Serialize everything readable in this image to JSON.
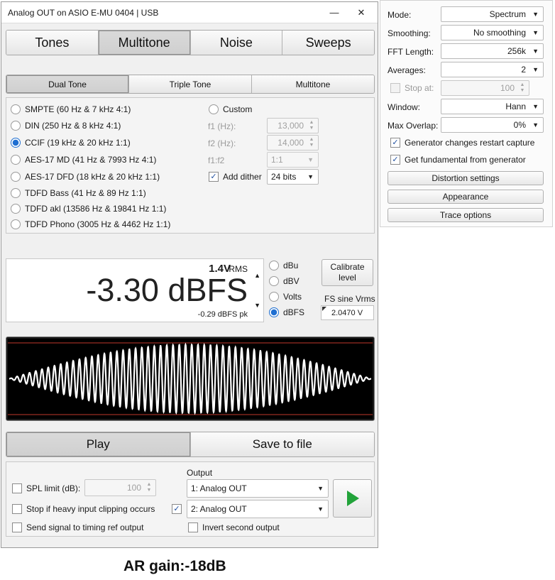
{
  "window": {
    "title": "Analog OUT on ASIO E-MU 0404 | USB",
    "minimize": "—",
    "maximize": "☐",
    "close": "✕"
  },
  "main_tabs": [
    {
      "label": "Tones",
      "selected": false
    },
    {
      "label": "Multitone",
      "selected": true
    },
    {
      "label": "Noise",
      "selected": false
    },
    {
      "label": "Sweeps",
      "selected": false
    }
  ],
  "sub_tabs": [
    {
      "label": "Dual Tone",
      "selected": true
    },
    {
      "label": "Triple Tone",
      "selected": false
    },
    {
      "label": "Multitone",
      "selected": false
    }
  ],
  "presets": [
    {
      "label": "SMPTE (60 Hz & 7 kHz 4:1)",
      "selected": false
    },
    {
      "label": "DIN (250 Hz & 8 kHz 4:1)",
      "selected": false
    },
    {
      "label": "CCIF (19 kHz & 20 kHz 1:1)",
      "selected": true
    },
    {
      "label": "AES-17 MD (41 Hz & 7993 Hz 4:1)",
      "selected": false
    },
    {
      "label": "AES-17 DFD (18 kHz & 20 kHz 1:1)",
      "selected": false
    },
    {
      "label": "TDFD Bass (41 Hz & 89 Hz 1:1)",
      "selected": false
    },
    {
      "label": "TDFD akl (13586 Hz & 19841 Hz 1:1)",
      "selected": false
    },
    {
      "label": "TDFD Phono (3005 Hz & 4462 Hz 1:1)",
      "selected": false
    }
  ],
  "custom": {
    "label": "Custom",
    "f1_label": "f1 (Hz):",
    "f1_value": "13,000",
    "f2_label": "f2 (Hz):",
    "f2_value": "14,000",
    "ratio_label": "f1:f2",
    "ratio_value": "1:1",
    "dither_label": "Add dither",
    "dither_checked": true,
    "dither_value": "24 bits"
  },
  "level": {
    "rms_value": "1.4V",
    "rms_unit": "RMS",
    "main": "-3.30 dBFS",
    "peak": "-0.29 dBFS pk",
    "units": [
      {
        "label": "dBu",
        "selected": false
      },
      {
        "label": "dBV",
        "selected": false
      },
      {
        "label": "Volts",
        "selected": false
      },
      {
        "label": "dBFS",
        "selected": true
      }
    ],
    "calibrate_line1": "Calibrate",
    "calibrate_line2": "level",
    "fs_label": "FS sine Vrms",
    "fs_value": "2.0470 V"
  },
  "scope": {
    "colors": {
      "background": "#000000",
      "trace": "#ffffff",
      "limit": "#c0392b"
    }
  },
  "play_tabs": [
    {
      "label": "Play",
      "selected": true
    },
    {
      "label": "Save to file",
      "selected": false
    }
  ],
  "bottom": {
    "spl_label": "SPL limit (dB):",
    "spl_value": "100",
    "stop_clip_label": "Stop if heavy input clipping occurs",
    "timing_label": "Send signal to timing ref output",
    "output_label": "Output",
    "output1": "1: Analog OUT",
    "output2": "2: Analog OUT",
    "output2_checked": true,
    "invert_label": "Invert second output"
  },
  "settings": {
    "mode_label": "Mode:",
    "mode_value": "Spectrum",
    "smoothing_label": "Smoothing:",
    "smoothing_value": "No smoothing",
    "fft_label": "FFT Length:",
    "fft_value": "256k",
    "averages_label": "Averages:",
    "averages_value": "2",
    "stopat_label": "Stop at:",
    "stopat_value": "100",
    "window_label": "Window:",
    "window_value": "Hann",
    "overlap_label": "Max Overlap:",
    "overlap_value": "0%",
    "gen_restart_label": "Generator changes restart capture",
    "fundamental_label": "Get fundamental from generator",
    "distortion_button": "Distortion settings",
    "appearance_button": "Appearance",
    "trace_button": "Trace options"
  },
  "caption": "AR gain:-18dB",
  "colors": {
    "accent": "#1f6fd1",
    "play": "#22a33a"
  }
}
